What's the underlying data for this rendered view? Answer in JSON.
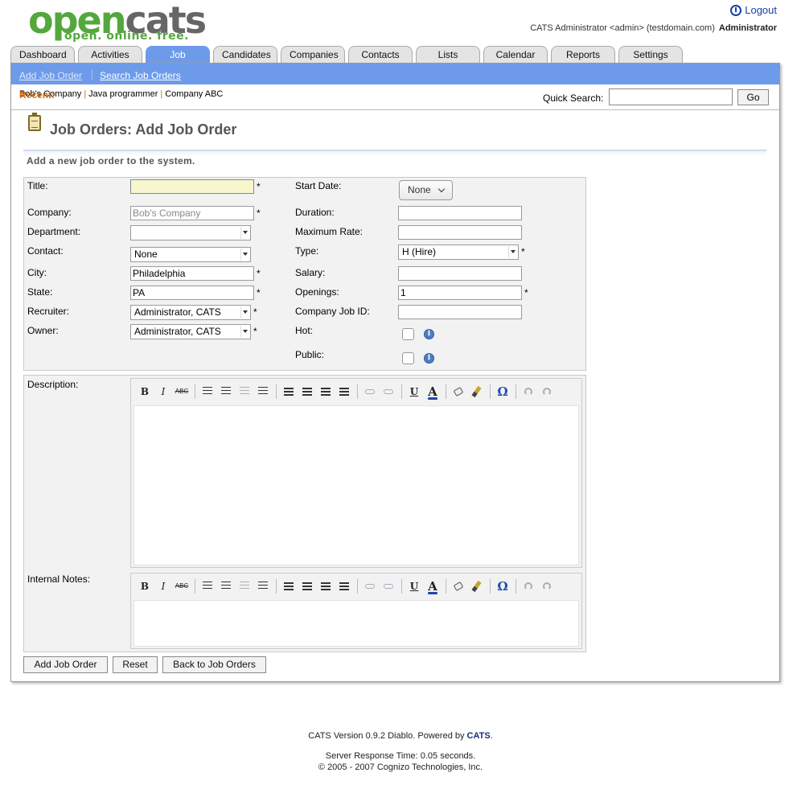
{
  "header": {
    "logo_open": "open",
    "logo_cats": "cats",
    "tagline": "open. online. free.",
    "logout": "Logout",
    "user_line": "CATS Administrator <admin> (testdomain.com)",
    "user_role": "Administrator"
  },
  "tabs": [
    "Dashboard",
    "Activities",
    "Job Orders",
    "Candidates",
    "Companies",
    "Contacts",
    "Lists",
    "Calendar",
    "Reports",
    "Settings"
  ],
  "subnav": {
    "add": "Add Job Order",
    "search": "Search Job Orders"
  },
  "recent": {
    "label": "Recent:",
    "items": [
      "Bob's Company",
      "Java programmer",
      "Company ABC"
    ]
  },
  "quick_search": {
    "label": "Quick Search:",
    "value": "",
    "go": "Go"
  },
  "page": {
    "title": "Job Orders: Add Job Order",
    "subtitle": "Add a new job order to the system."
  },
  "form": {
    "labels": {
      "title": "Title:",
      "company": "Company:",
      "department": "Department:",
      "contact": "Contact:",
      "city": "City:",
      "state": "State:",
      "recruiter": "Recruiter:",
      "owner": "Owner:",
      "start_date": "Start Date:",
      "duration": "Duration:",
      "max_rate": "Maximum Rate:",
      "type": "Type:",
      "salary": "Salary:",
      "openings": "Openings:",
      "company_job_id": "Company Job ID:",
      "hot": "Hot:",
      "public": "Public:",
      "description": "Description:",
      "internal_notes": "Internal Notes:"
    },
    "values": {
      "title": "",
      "company": "Bob's Company",
      "department": "",
      "contact": "None",
      "city": "Philadelphia",
      "state": "PA",
      "recruiter": "Administrator, CATS",
      "owner": "Administrator, CATS",
      "start_date": "None",
      "duration": "",
      "max_rate": "",
      "type": "H (Hire)",
      "salary": "",
      "openings": "1",
      "company_job_id": ""
    },
    "required_mark": "*"
  },
  "editor_toolbar": {
    "bold": "B",
    "italic": "I",
    "strike": "ABC",
    "underline": "U",
    "text_color": "A",
    "special_char": "Ω"
  },
  "buttons": {
    "add": "Add Job Order",
    "reset": "Reset",
    "back": "Back to Job Orders"
  },
  "footer": {
    "version": "CATS Version 0.9.2 Diablo. Powered by ",
    "brand": "CATS",
    "period": ".",
    "response": "Server Response Time: 0.05 seconds.",
    "copyright": "© 2005 - 2007 Cognizo Technologies, Inc."
  }
}
